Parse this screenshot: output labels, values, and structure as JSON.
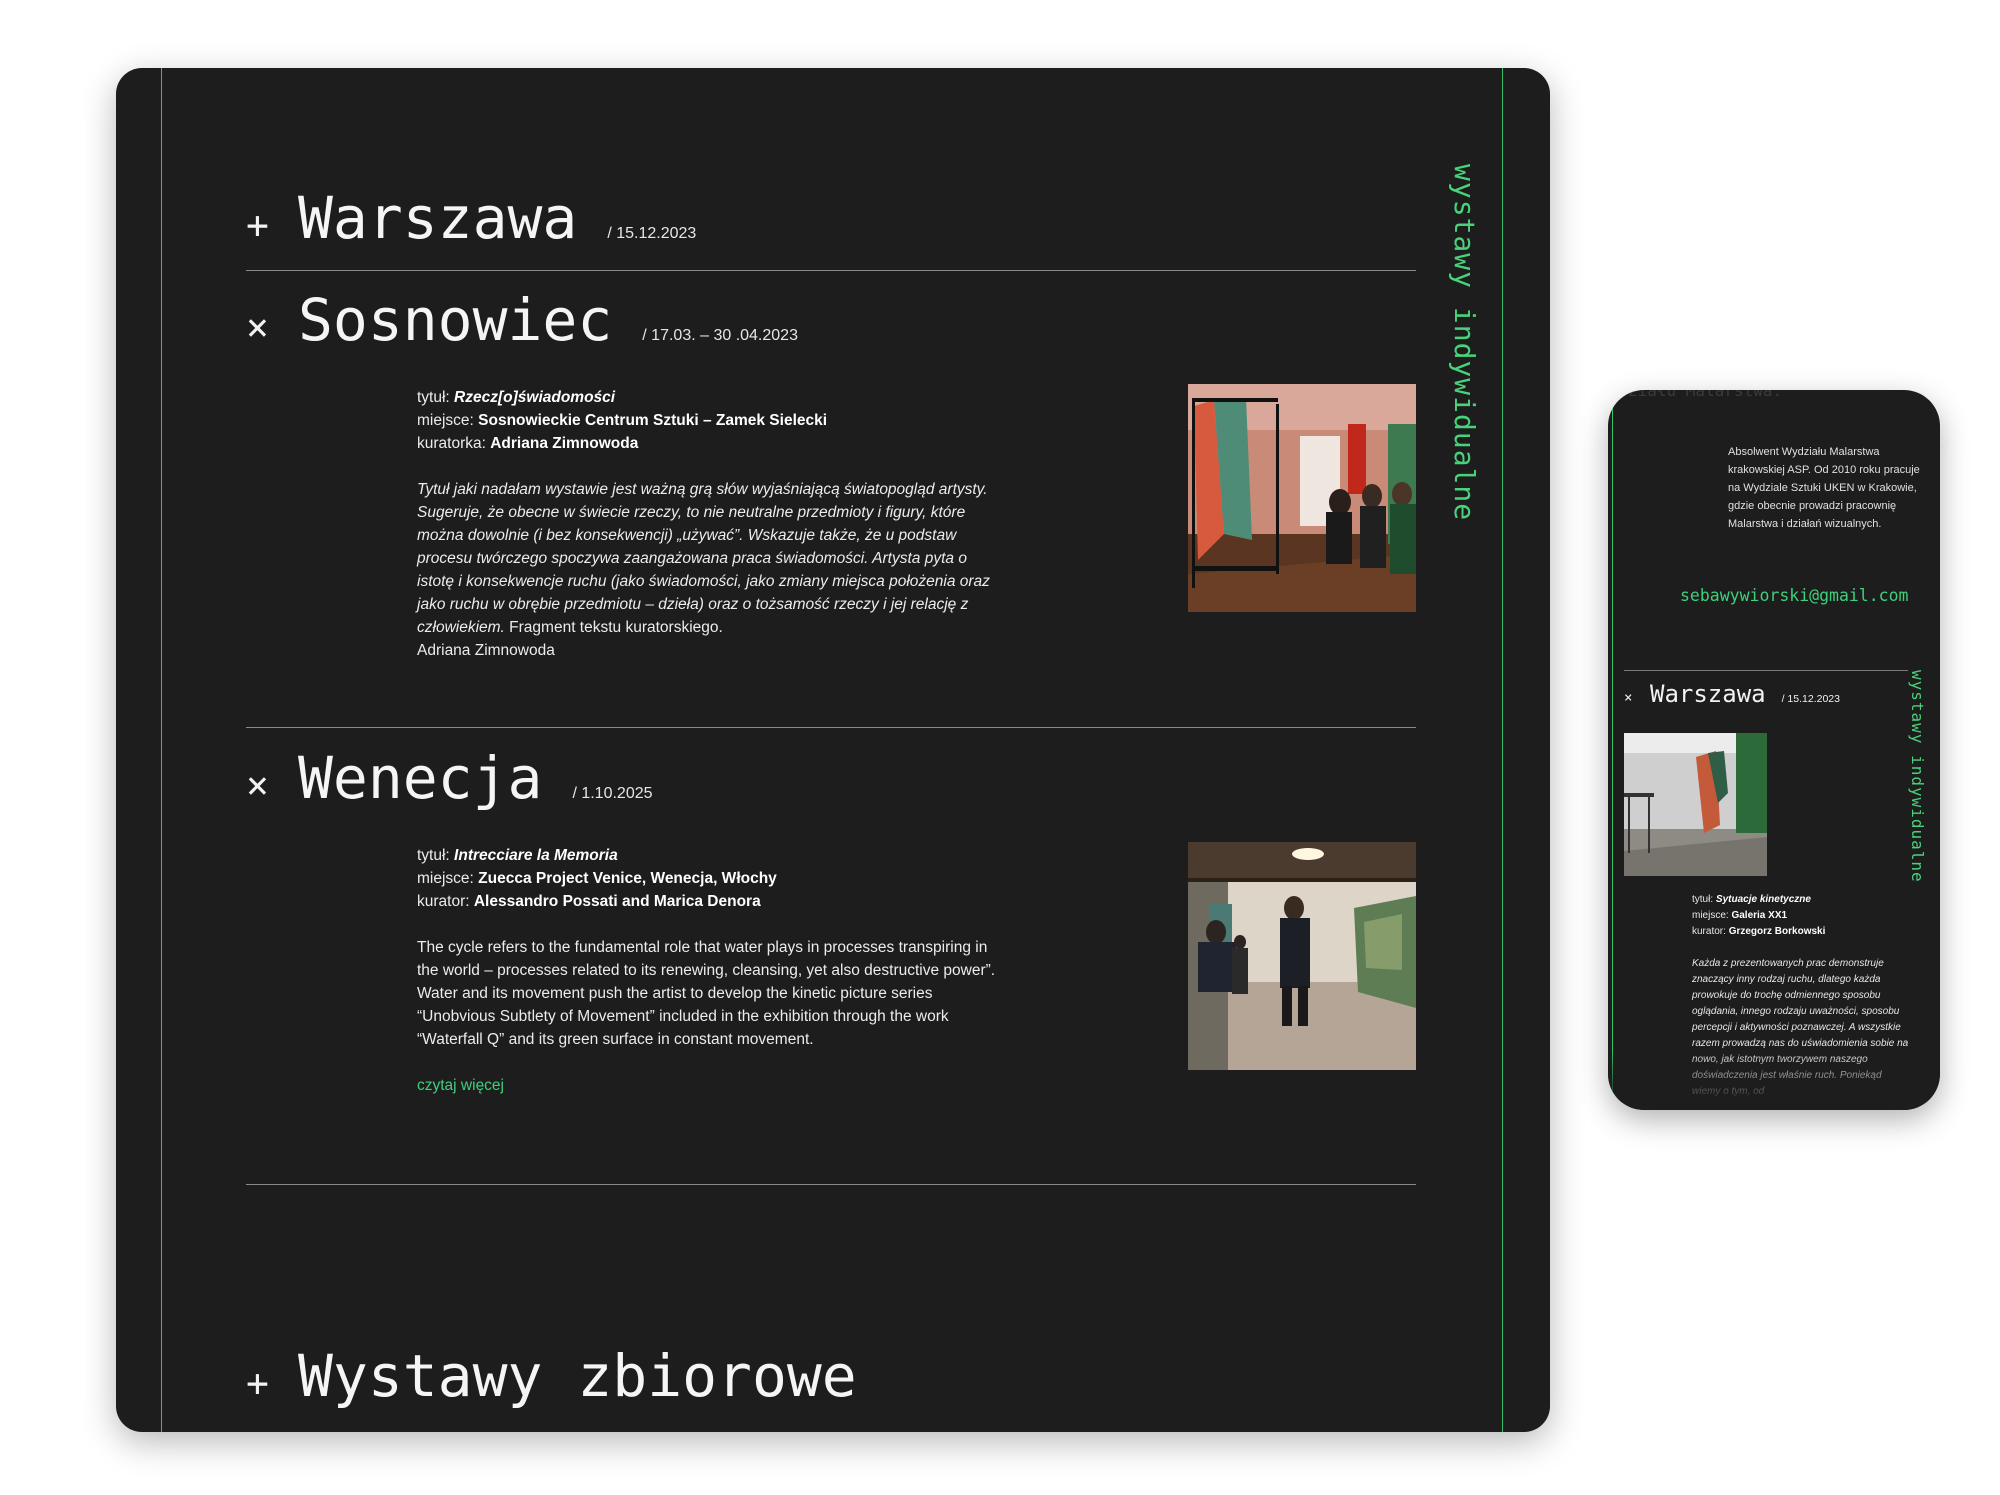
{
  "desktop": {
    "side_label": "wystawy indywidualne",
    "sections": [
      {
        "symbol": "+",
        "city": "Warszawa",
        "date": "/ 15.12.2023"
      },
      {
        "symbol": "×",
        "city": "Sosnowiec",
        "date": "/ 17.03. – 30 .04.2023",
        "title_label": "tytuł: ",
        "title": "Rzecz[o]świadomości",
        "place_label": "miejsce: ",
        "place": "Sosnowieckie Centrum Sztuki – Zamek Sielecki",
        "curator_label": "kuratorka: ",
        "curator": "Adriana Zimnowoda",
        "desc_italic": "Tytuł jaki nadałam wystawie jest ważną grą słów wyjaśniającą światopogląd artysty. Sugeruje, że obecne w świecie rzeczy, to nie neutralne przedmioty i figury, które można dowolnie (i bez konsekwencji) „używać”. Wskazuje także, że u podstaw procesu twórczego spoczywa zaangażowana praca świadomości. Artysta pyta o istotę i konsekwencje ruchu (jako świadomości, jako zmiany miejsca położenia oraz jako ruchu w obrębie przedmiotu – dzieła) oraz o tożsamość rzeczy i jej relację z człowiekiem.",
        "desc_plain": " Fragment tekstu kuratorskiego.",
        "desc_author": "Adriana Zimnowoda"
      },
      {
        "symbol": "×",
        "city": "Wenecja",
        "date": "/ 1.10.2025",
        "title_label": "tytuł: ",
        "title": "Intrecciare la Memoria",
        "place_label": "miejsce: ",
        "place": "Zuecca Project Venice, Wenecja, Włochy",
        "curator_label": "kurator: ",
        "curator": "Alessandro Possati and Marica Denora",
        "desc": "The cycle refers to the fundamental role that water plays in processes transpiring in the world – processes related to its renewing, cleansing, yet also destructive power”. Water and its movement push the artist to develop the kinetic picture series “Unobvious Subtlety of Movement” included in the exhibition through the work “Waterfall Q” and its green surface in constant movement.",
        "read_more": "czytaj więcej"
      },
      {
        "symbol": "+",
        "city": "Wystawy zbiorowe"
      }
    ]
  },
  "mobile": {
    "ghost_text": "ziału Malarstwa.",
    "bio": "Absolwent Wydziału Malarstwa krakowskiej ASP. Od 2010 roku pracuje na Wydziale Sztuki UKEN w Krakowie, gdzie obecnie prowadzi pracownię Malarstwa i działań wizualnych.",
    "email": "sebawywiorski@gmail.com",
    "side_label": "wystawy indywidualne",
    "section": {
      "symbol": "×",
      "city": "Warszawa",
      "date": "/ 15.12.2023",
      "title_label": "tytuł: ",
      "title": "Sytuacje kinetyczne",
      "place_label": "miejsce: ",
      "place": "Galeria XX1",
      "curator_label": "kurator: ",
      "curator": "Grzegorz Borkowski",
      "desc": "Każda z prezentowanych prac demonstruje znaczący inny rodzaj ruchu, dlatego każda prowokuje do trochę odmiennego sposobu oglądania, innego rodzaju uważności, sposobu percepcji i aktywności poznawczej. A wszystkie razem prowadzą nas do uświadomienia sobie na nowo, jak istotnym tworzywem naszego doświadczenia jest właśnie ruch. Poniekąd wiemy o tym, od"
    }
  },
  "colors": {
    "background": "#1d1d1d",
    "accent": "#3ed07a",
    "page": "#ffffff"
  }
}
